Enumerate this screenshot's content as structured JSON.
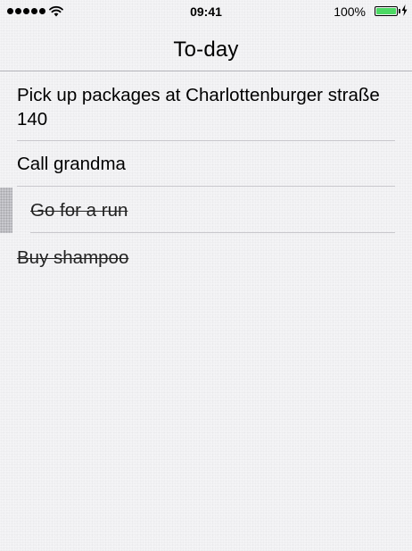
{
  "status_bar": {
    "time": "09:41",
    "battery_percent": "100%",
    "battery_level": 1.0,
    "battery_color": "#4cd964",
    "signal_bars": 5,
    "icons": [
      "signal-dots-icon",
      "wifi-icon",
      "battery-icon",
      "charging-bolt-icon"
    ]
  },
  "nav": {
    "title": "To-day"
  },
  "todos": [
    {
      "text": "Pick up packages at Charlottenburger straße 140",
      "done": false
    },
    {
      "text": "Call grandma",
      "done": false
    },
    {
      "text": "Go for a run",
      "done": true
    },
    {
      "text": "Buy shampoo",
      "done": true
    }
  ]
}
